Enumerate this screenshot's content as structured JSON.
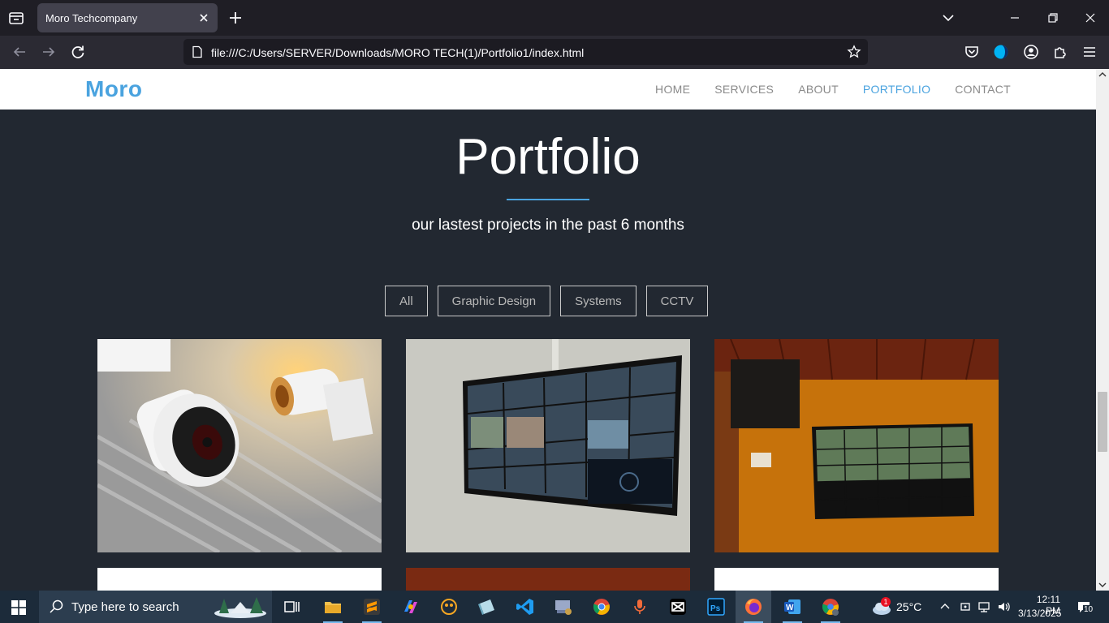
{
  "browser": {
    "tab_title": "Moro Techcompany",
    "url": "file:///C:/Users/SERVER/Downloads/MORO TECH(1)/Portfolio1/index.html"
  },
  "site": {
    "logo": "Moro",
    "nav": [
      "HOME",
      "SERVICES",
      "ABOUT",
      "PORTFOLIO",
      "CONTACT"
    ],
    "active_nav": "PORTFOLIO",
    "accent_color": "#4aa3df"
  },
  "portfolio": {
    "title": "Portfolio",
    "subtitle": "our lastest projects in the past 6 months",
    "filters": [
      "All",
      "Graphic Design",
      "Systems",
      "CCTV"
    ],
    "items": [
      "cctv-cameras-image",
      "wall-monitor-cctv-feed-image",
      "monitor-on-orange-wall-image"
    ]
  },
  "taskbar": {
    "search_placeholder": "Type here to search",
    "weather_temp": "25°C",
    "weather_badge": "1",
    "time": "12:11 PM",
    "date": "3/13/2025",
    "notifications": "10"
  }
}
